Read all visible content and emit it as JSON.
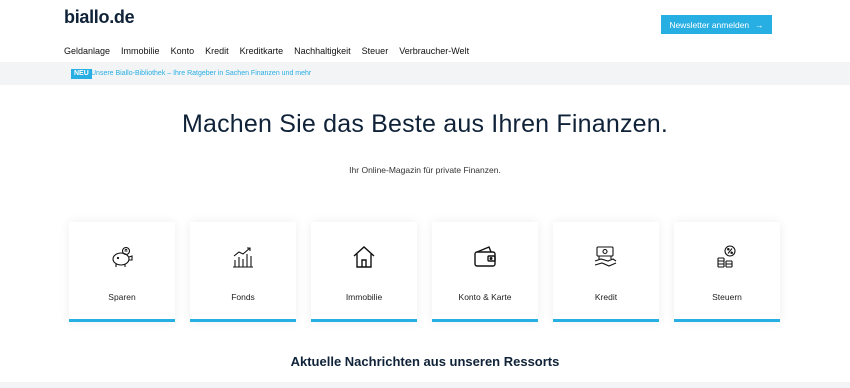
{
  "header": {
    "logo": "biallo.de",
    "newsletter_label": "Newsletter anmelden",
    "newsletter_arrow": "→"
  },
  "nav": [
    "Geldanlage",
    "Immobilie",
    "Konto",
    "Kredit",
    "Kreditkarte",
    "Nachhaltigkeit",
    "Steuer",
    "Verbraucher-Welt"
  ],
  "banner": {
    "badge": "NEU",
    "text": "Unsere Biallo-Bibliothek – Ihre Ratgeber in Sachen Finanzen und mehr"
  },
  "hero": {
    "title": "Machen Sie das Beste aus Ihren Finanzen.",
    "subtitle": "Ihr Online-Magazin für private Finanzen."
  },
  "categories": [
    {
      "label": "Sparen",
      "icon": "piggy-bank-icon"
    },
    {
      "label": "Fonds",
      "icon": "chart-icon"
    },
    {
      "label": "Immobilie",
      "icon": "house-icon"
    },
    {
      "label": "Konto & Karte",
      "icon": "wallet-icon"
    },
    {
      "label": "Kredit",
      "icon": "money-hand-icon"
    },
    {
      "label": "Steuern",
      "icon": "coins-percent-icon"
    }
  ],
  "news": {
    "title": "Aktuelle Nachrichten aus unseren Ressorts"
  },
  "colors": {
    "accent": "#27aee3",
    "navy": "#0f2238",
    "banner_bg": "#f3f4f6"
  }
}
